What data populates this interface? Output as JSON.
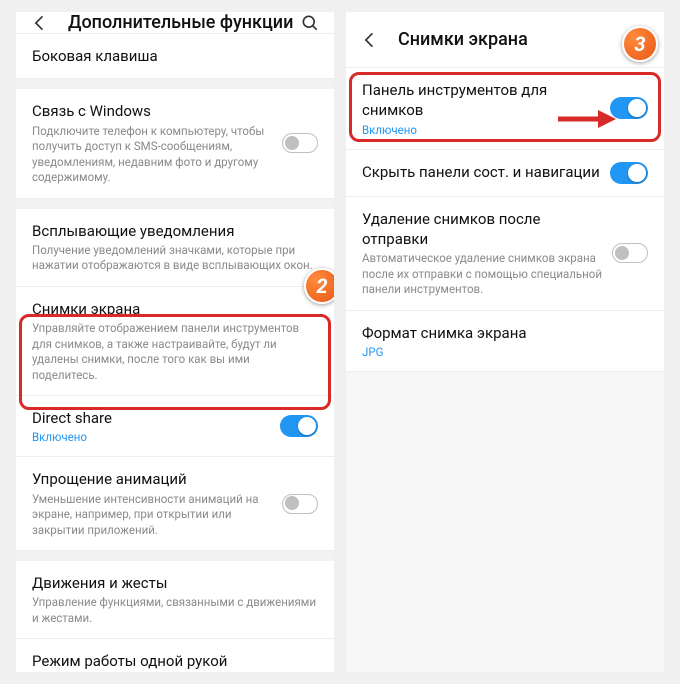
{
  "left": {
    "title": "Дополнительные функции",
    "rows": {
      "side_key": {
        "title": "Боковая клавиша"
      },
      "windows": {
        "title": "Связь с Windows",
        "desc": "Подключите телефон к компьютеру, чтобы получить доступ к SMS-сообщениям, уведомлениям, недавним фото и другому содержимому."
      },
      "popup": {
        "title": "Всплывающие уведомления",
        "desc": "Получение уведомлений значками, которые при нажатии отображаются в виде всплывающих окон."
      },
      "screenshots": {
        "title": "Снимки экрана",
        "desc": "Управляйте отображением панели инструментов для снимков, а также настраивайте, будут ли удалены снимки, после того как вы ими поделитесь."
      },
      "direct_share": {
        "title": "Direct share",
        "status": "Включено"
      },
      "reduce_anim": {
        "title": "Упрощение анимаций",
        "desc": "Уменьшение интенсивности анимаций на экране, например, при открытии или закрытии приложений."
      },
      "motions": {
        "title": "Движения и жесты",
        "desc": "Управление функциями, связанными с движениями и жестами."
      },
      "one_hand": {
        "title": "Режим работы одной рукой"
      }
    }
  },
  "right": {
    "title": "Снимки экрана",
    "rows": {
      "toolbar": {
        "title": "Панель инструментов для снимков",
        "status": "Включено"
      },
      "hide_bars": {
        "title": "Скрыть панели сост. и навигации"
      },
      "delete_after": {
        "title": "Удаление снимков после отправки",
        "desc": "Автоматическое удаление снимков экрана после их отправки с помощью специальной панели инструментов."
      },
      "format": {
        "title": "Формат снимка экрана",
        "status": "JPG"
      }
    }
  },
  "badges": {
    "b2": "2",
    "b3": "3"
  }
}
